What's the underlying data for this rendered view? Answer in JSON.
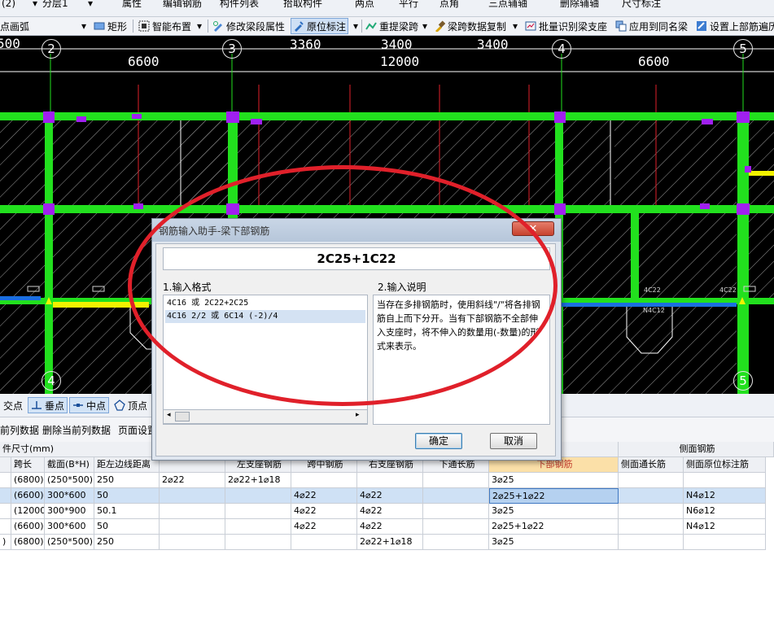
{
  "toolbar_top": {
    "layer_combo_value": "(2)",
    "floor_combo_value": "分层1",
    "items": [
      "属性",
      "编辑钢筋",
      "构件列表",
      "拾取构件",
      "两点",
      "平行",
      "点角",
      "三点辅轴",
      "删除辅轴",
      "尺寸标注"
    ]
  },
  "toolbar_main": {
    "arc_mode": "点画弧",
    "rect_label": "矩形",
    "smart_layout_label": "智能布置",
    "modify_segment_label": "修改梁段属性",
    "in_situ_label": "原位标注",
    "reextract_span_label": "重提梁跨",
    "copy_span_data_label": "梁跨数据复制",
    "batch_identify_label": "批量识别梁支座",
    "apply_same_name_label": "应用到同名梁",
    "set_top_rebar_label": "设置上部筋遍历"
  },
  "cad": {
    "dims_top": [
      "3360",
      "3400",
      "3400"
    ],
    "dims_mid": [
      "6600",
      "12000",
      "6600"
    ],
    "axis_top": [
      "2",
      "3",
      "4",
      "5"
    ],
    "axis_bottom": [
      "4",
      "5"
    ],
    "beam_tags": [
      "4C22",
      "4C22",
      "N4C12"
    ]
  },
  "snap_bar": {
    "items": [
      "交点",
      "垂点",
      "中点",
      "顶点"
    ]
  },
  "table_toolbar": {
    "paste_col_label": "前列数据",
    "delete_col_label": "删除当前列数据",
    "page_setup_label": "页面设置"
  },
  "grid": {
    "caption": "件尺寸(mm)",
    "side_group": "侧面钢筋",
    "columns": [
      "跨长",
      "截面(B*H)",
      "距左边线距离",
      "",
      "左支座钢筋",
      "跨中钢筋",
      "右支座钢筋",
      "下通长筋",
      "下部钢筋",
      "侧面通长筋",
      "侧面原位标注筋"
    ],
    "rows": [
      [
        "(6800)",
        "(250*500)",
        "250",
        "2⌀22",
        "2⌀22+1⌀18",
        "",
        "",
        "",
        "3⌀25",
        "",
        ""
      ],
      [
        "(6600)",
        "300*600",
        "50",
        "",
        "",
        "4⌀22",
        "4⌀22",
        "",
        "2⌀25+1⌀22",
        "",
        "N4⌀12"
      ],
      [
        "(12000",
        "300*900",
        "50.1",
        "",
        "",
        "4⌀22",
        "4⌀22",
        "",
        "3⌀25",
        "",
        "N6⌀12"
      ],
      [
        "(6600)",
        "300*600",
        "50",
        "",
        "",
        "4⌀22",
        "4⌀22",
        "",
        "2⌀25+1⌀22",
        "",
        "N4⌀12"
      ],
      [
        "(6800)",
        "(250*500)",
        "250",
        "",
        "",
        "",
        "2⌀22+1⌀18",
        "",
        "3⌀25",
        "",
        ""
      ]
    ],
    "left_partial_col": [
      "",
      "",
      "",
      "",
      ")"
    ]
  },
  "dialog": {
    "title": "钢筋输入助手-梁下部钢筋",
    "close_glyph": "✕",
    "format_value": "2C25+1C22",
    "section_format": "1.输入格式",
    "section_desc": "2.输入说明",
    "format_items": [
      "4C16 或 2C22+2C25",
      "4C16 2/2 或 6C14 (-2)/4"
    ],
    "description": "当存在多排钢筋时，使用斜线\"/\"将各排钢筋自上而下分开。当有下部钢筋不全部伸入支座时，将不伸入的数量用(-数量)的形式来表示。",
    "ok_label": "确定",
    "cancel_label": "取消"
  },
  "colors": {
    "beam_green": "#22e01e",
    "purple_node": "#a020f0",
    "highlight_yellow": "#f2f200",
    "axis_blue": "#1a6fe0",
    "annotation_red": "#e0202a",
    "header_active": "#fbe0a8"
  }
}
